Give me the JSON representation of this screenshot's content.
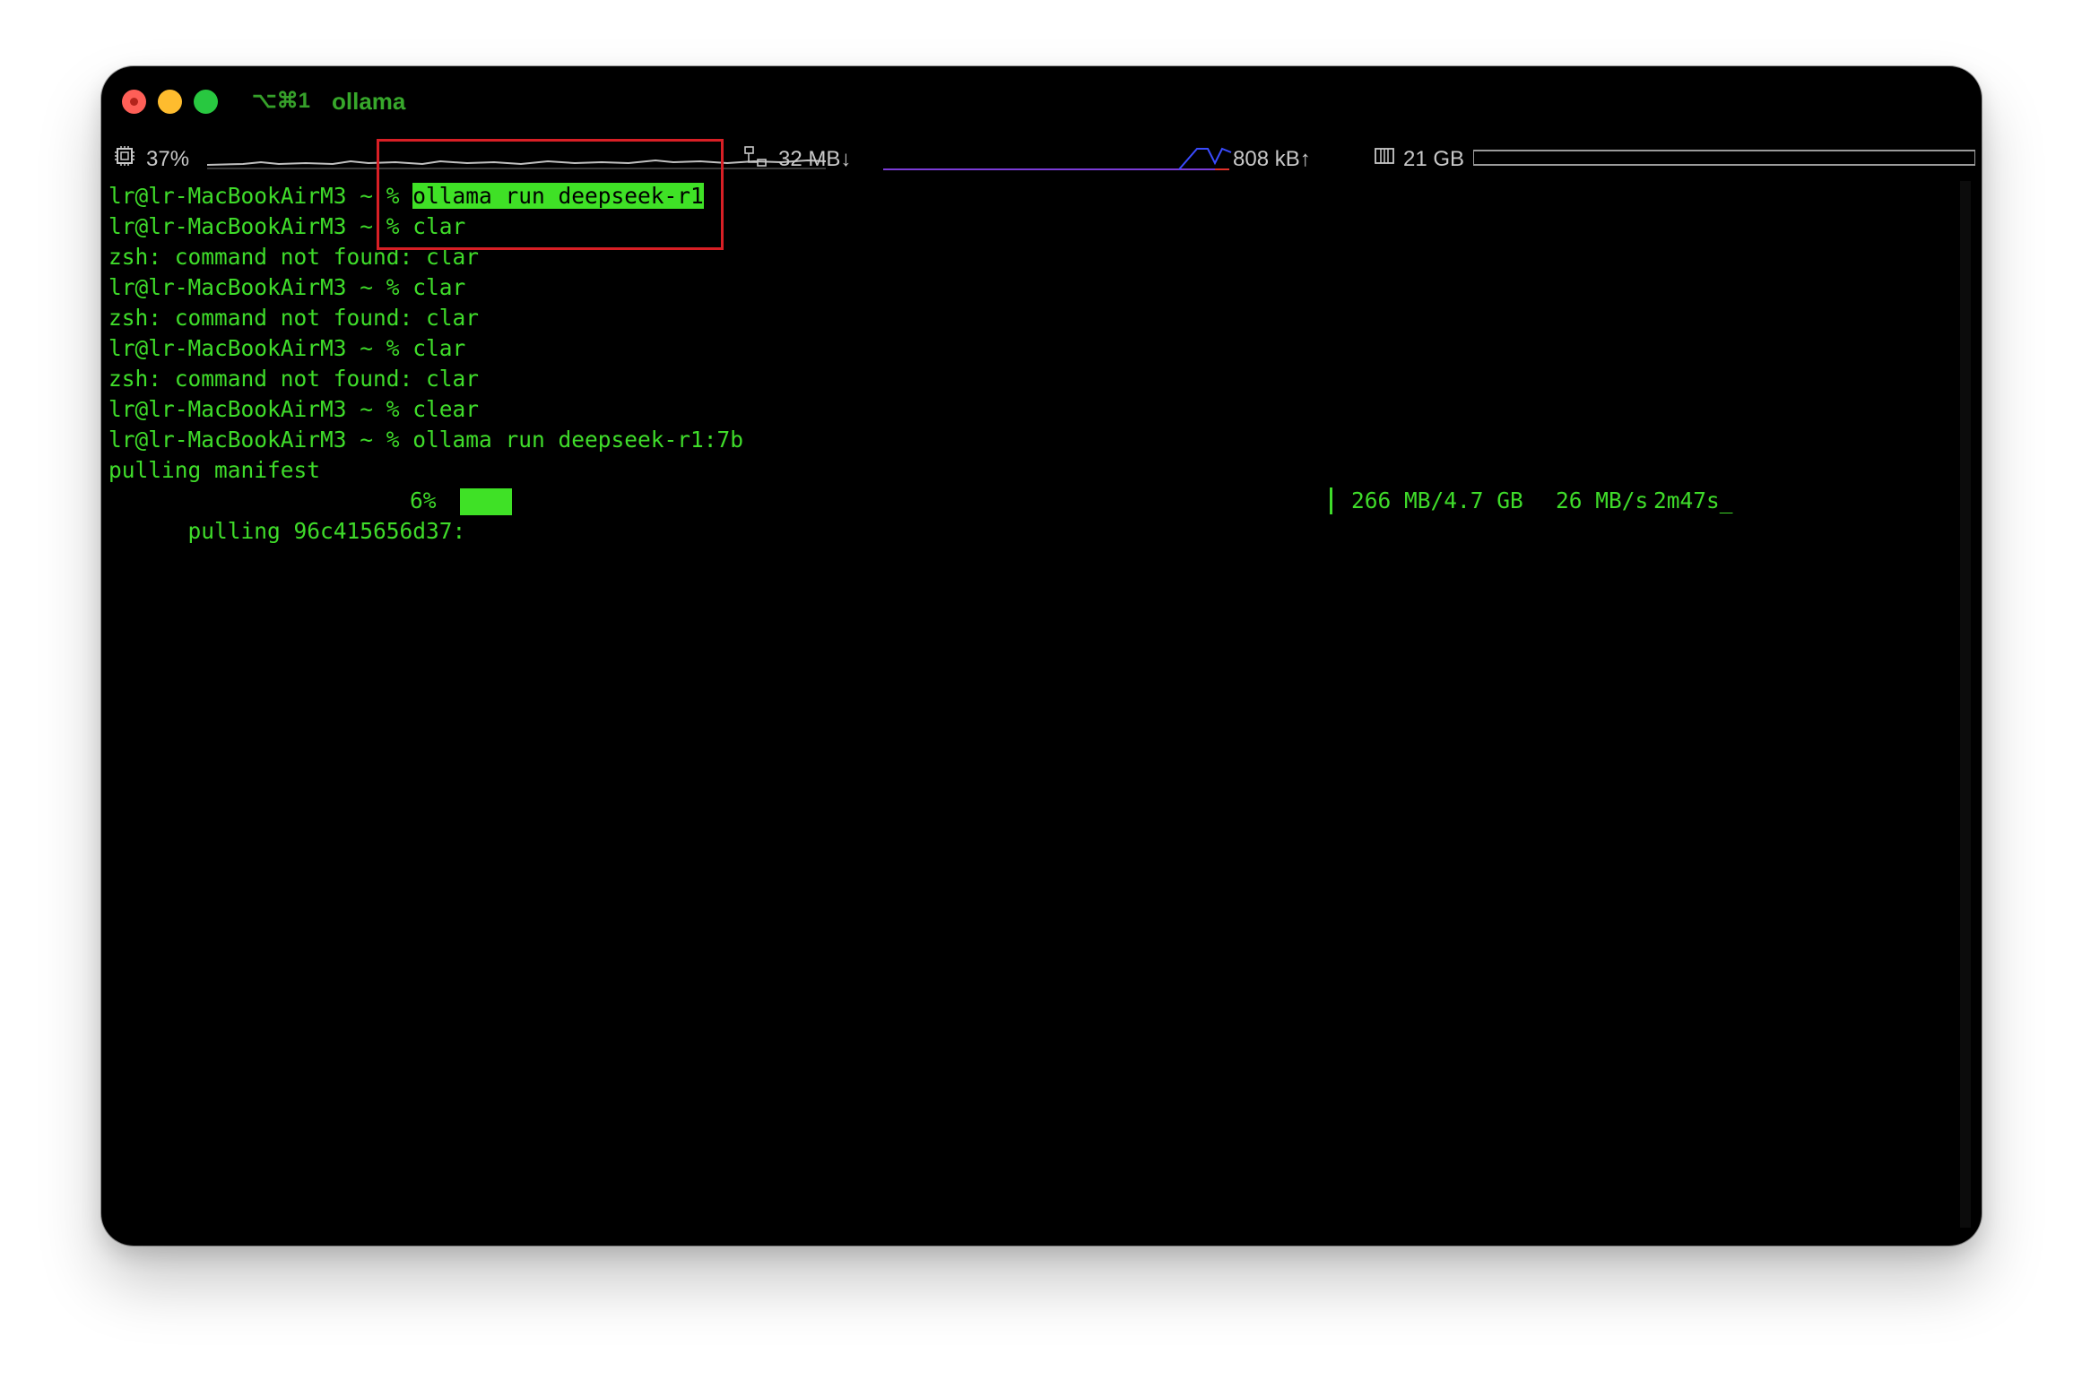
{
  "window": {
    "shortcut": "⌥⌘1",
    "title": "ollama"
  },
  "statusbar": {
    "cpu": "37%",
    "net_down": "32 MB↓",
    "net_up": "808 kB↑",
    "memory": "21 GB"
  },
  "terminal": {
    "lines": [
      {
        "prompt": "lr@lr-MacBookAirM3 ~ % ",
        "command": "ollama run deepseek-r1",
        "highlight": true
      },
      {
        "prompt": "lr@lr-MacBookAirM3 ~ % ",
        "command": "clar"
      },
      {
        "text": "zsh: command not found: clar"
      },
      {
        "prompt": "lr@lr-MacBookAirM3 ~ % ",
        "command": "clar"
      },
      {
        "text": "zsh: command not found: clar"
      },
      {
        "prompt": "lr@lr-MacBookAirM3 ~ % ",
        "command": "clar"
      },
      {
        "text": "zsh: command not found: clar"
      },
      {
        "prompt": "lr@lr-MacBookAirM3 ~ % ",
        "command": "clear"
      },
      {
        "prompt": "lr@lr-MacBookAirM3 ~ % ",
        "command": "ollama run deepseek-r1:7b"
      },
      {
        "text": "pulling manifest"
      }
    ],
    "progress": {
      "label": "pulling 96c415656d37:",
      "percent_text": "6%",
      "fraction": 0.06,
      "size": "266 MB/4.7 GB",
      "speed": "26 MB/s",
      "eta": "2m47s",
      "cursor": "_"
    }
  },
  "colors": {
    "terminal_text": "#3fdc2a",
    "highlight_bg": "#3fe126",
    "annotation_box": "#d81f25"
  }
}
